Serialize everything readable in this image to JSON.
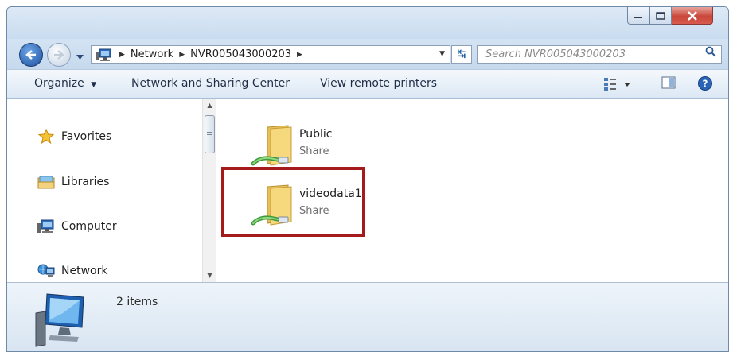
{
  "address_bar": {
    "segments": [
      "Network",
      "NVR005043000203"
    ]
  },
  "search": {
    "placeholder": "Search NVR005043000203"
  },
  "toolbar": {
    "organize_label": "Organize",
    "network_sharing_label": "Network and Sharing Center",
    "remote_printers_label": "View remote printers"
  },
  "nav_pane": {
    "items": [
      {
        "label": "Favorites",
        "icon": "star-icon"
      },
      {
        "label": "Libraries",
        "icon": "libraries-icon"
      },
      {
        "label": "Computer",
        "icon": "computer-icon"
      },
      {
        "label": "Network",
        "icon": "network-icon"
      }
    ]
  },
  "files": [
    {
      "name": "Public",
      "type": "Share",
      "icon": "shared-folder-icon",
      "highlighted": false
    },
    {
      "name": "videodata1",
      "type": "Share",
      "icon": "shared-folder-icon",
      "highlighted": true
    }
  ],
  "details_pane": {
    "item_count": "2 items",
    "icon": "computer-icon"
  },
  "colors": {
    "highlight": "#a51b1b",
    "window_frame": "#cfe0f1",
    "close_button": "#c9463a"
  }
}
